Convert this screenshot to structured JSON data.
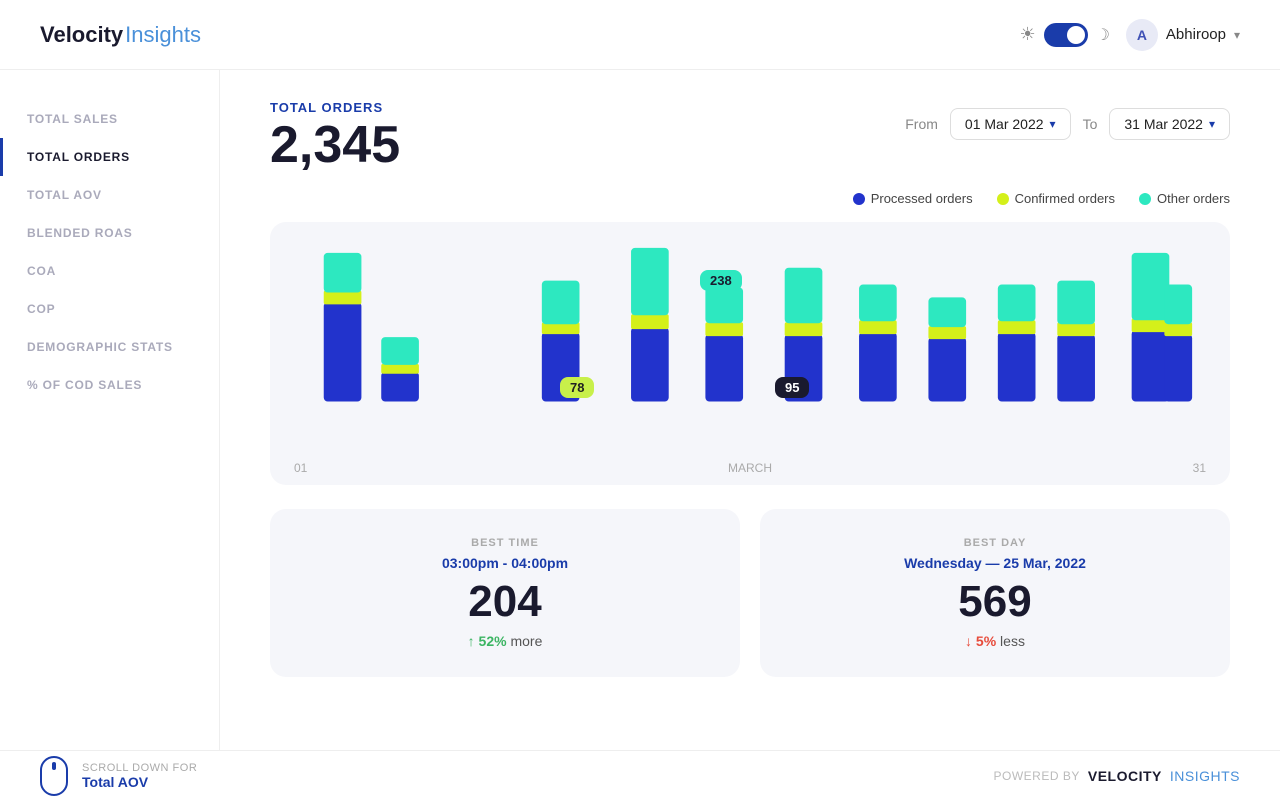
{
  "header": {
    "logo_velocity": "Velocity",
    "logo_insights": "Insights",
    "user_name": "Abhiroop",
    "user_initials": "A"
  },
  "sidebar": {
    "items": [
      {
        "id": "total-sales",
        "label": "TOTAL SALES",
        "active": false
      },
      {
        "id": "total-orders",
        "label": "TOTAL ORDERS",
        "active": true
      },
      {
        "id": "total-aov",
        "label": "TOTAL AOV",
        "active": false
      },
      {
        "id": "blended-roas",
        "label": "BLENDED ROAS",
        "active": false
      },
      {
        "id": "coa",
        "label": "COA",
        "active": false
      },
      {
        "id": "cop",
        "label": "COP",
        "active": false
      },
      {
        "id": "demographic-stats",
        "label": "DEMOGRAPHIC STATS",
        "active": false
      },
      {
        "id": "pct-cod-sales",
        "label": "% OF COD SALES",
        "active": false
      }
    ]
  },
  "main": {
    "stat_label": "TOTAL ORDERS",
    "stat_value": "2,345",
    "date_from_label": "From",
    "date_from_value": "01 Mar 2022",
    "date_to_label": "To",
    "date_to_value": "31 Mar 2022",
    "legend": [
      {
        "label": "Processed orders",
        "color": "#2233cc"
      },
      {
        "label": "Confirmed orders",
        "color": "#d4f01a"
      },
      {
        "label": "Other orders",
        "color": "#2de8c0"
      }
    ],
    "chart": {
      "x_start": "01",
      "x_middle": "MARCH",
      "x_end": "31",
      "tooltips": [
        {
          "value": "78",
          "type": "green"
        },
        {
          "value": "238",
          "type": "teal"
        },
        {
          "value": "95",
          "type": "dark"
        }
      ]
    },
    "best_time": {
      "sub": "BEST TIME",
      "time": "03:00pm - 04:00pm",
      "value": "204",
      "change_direction": "up",
      "change_pct": "52%",
      "change_label": "more"
    },
    "best_day": {
      "sub": "BEST DAY",
      "day": "Wednesday — 25 Mar, 2022",
      "value": "569",
      "change_direction": "down",
      "change_pct": "5%",
      "change_label": "less"
    }
  },
  "footer": {
    "scroll_hint": "SCROLL DOWN FOR",
    "scroll_link": "Total AOV",
    "powered_by": "POWERED BY",
    "powered_velocity": "Velocity",
    "powered_insights": "Insights"
  }
}
